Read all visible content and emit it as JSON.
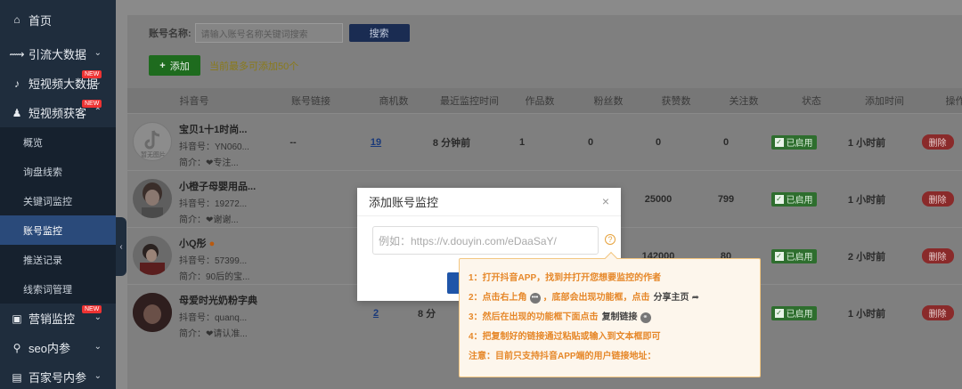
{
  "sidebar": {
    "items": [
      {
        "label": "首页",
        "icon": "home-icon",
        "chevron": false
      },
      {
        "label": "引流大数据",
        "icon": "pulse-icon",
        "chevron": true
      },
      {
        "label": "短视频大数据",
        "icon": "tiktok-icon",
        "chevron": true,
        "badge": "NEW"
      },
      {
        "label": "短视频获客",
        "icon": "users-icon",
        "chevron": true,
        "badge": "NEW"
      }
    ],
    "subitems": [
      "概览",
      "询盘线索",
      "关键词监控",
      "账号监控",
      "推送记录",
      "线索词管理"
    ],
    "active_sub": "账号监控",
    "bottom_items": [
      {
        "label": "营销监控",
        "icon": "monitor-icon",
        "chevron": true,
        "badge": "NEW"
      },
      {
        "label": "seo内参",
        "icon": "seo-icon",
        "chevron": true
      },
      {
        "label": "百家号内参",
        "icon": "baijia-icon",
        "chevron": true
      }
    ]
  },
  "search": {
    "label": "账号名称:",
    "placeholder": "请输入账号名称关键词搜索",
    "button": "搜索"
  },
  "add": {
    "button": "添加",
    "tip": "当前最多可添加50个"
  },
  "table": {
    "headers": [
      "抖音号",
      "账号链接",
      "商机数",
      "最近监控时间",
      "作品数",
      "粉丝数",
      "获赞数",
      "关注数",
      "状态",
      "添加时间",
      "操作"
    ],
    "rows": [
      {
        "name": "宝贝1十1时尚...",
        "douyin": "抖音号：YN060...",
        "bio": "简介：❤专注...",
        "avatar_text": "暂无图片",
        "link": "--",
        "leads": "19",
        "last_monitor": "8 分钟前",
        "works": "1",
        "fans": "0",
        "likes": "0",
        "follows": "0",
        "status": "已启用",
        "added": "1 小时前",
        "action": "删除"
      },
      {
        "name": "小橙子母婴用品...",
        "douyin": "抖音号：19272...",
        "bio": "简介：❤谢谢...",
        "avatar_text": "",
        "link": "",
        "leads": "",
        "last_monitor": "",
        "works": "",
        "fans": "",
        "likes": "25000",
        "follows": "799",
        "status": "已启用",
        "added": "1 小时前",
        "action": "删除"
      },
      {
        "name": "小Q彤",
        "douyin": "抖音号：57399...",
        "bio": "简介：90后的宝...",
        "avatar_text": "",
        "link": "",
        "leads": "",
        "last_monitor": "",
        "works": "",
        "fans": "",
        "likes": "142000",
        "follows": "80",
        "status": "已启用",
        "added": "2 小时前",
        "action": "删除"
      },
      {
        "name": "母爱时光奶粉字典",
        "douyin": "抖音号：quanq...",
        "bio": "简介：❤请认准...",
        "avatar_text": "",
        "link": "",
        "leads": "2",
        "last_monitor": "8 分",
        "works": "",
        "fans": "",
        "likes": "",
        "follows": "",
        "status": "已启用",
        "added": "1 小时前",
        "action": "删除"
      }
    ]
  },
  "modal": {
    "title": "添加账号监控",
    "close": "×",
    "input_placeholder": "例如：https://v.douyin.com/eDaaSaY/",
    "help": "?"
  },
  "tooltip": {
    "step1": "1：打开抖音APP，找到并打开您想要监控的作者",
    "step2_a": "2：点击右上角",
    "step2_b": "，底部会出现功能框，点击",
    "step2_c": "分享主页",
    "step3_a": "3：然后在出现的功能框下面点击",
    "step3_b": "复制链接",
    "step4": "4：把复制好的链接通过粘贴或输入到文本框即可",
    "note": "注意：目前只支持抖音APP端的用户链接地址："
  },
  "colors": {
    "sidebar_bg": "#1f2d3d",
    "active_bg": "#2a4a7a",
    "tip_text": "#e6882a",
    "tip_bg": "#fdf6ec",
    "primary": "#1f55a8",
    "success": "#67c23a",
    "danger": "#f56c6c"
  }
}
